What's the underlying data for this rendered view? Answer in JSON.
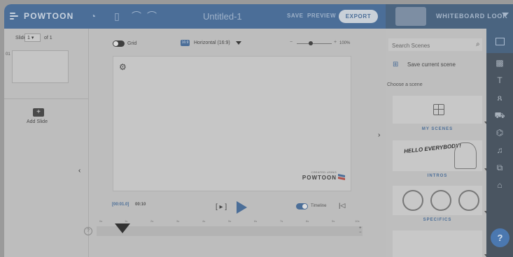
{
  "app": {
    "logo_text": "POWTOON",
    "document_title": "Untitled-1",
    "save_label": "SAVE",
    "preview_label": "PREVIEW",
    "export_label": "EXPORT",
    "look_label": "WHITEBOARD LOOK",
    "colors": {
      "brand": "#4b6e98",
      "header": "#4b6e98",
      "dim_overlay": "#bdbdbd"
    }
  },
  "slides_panel": {
    "slide_label": "Slide",
    "current_slide": "1",
    "of_label": "of 1",
    "slide_number": "01",
    "add_slide_label": "Add Slide"
  },
  "canvas": {
    "grid_label": "Grid",
    "ratio_badge": "16:9",
    "ratio_label": "Horizontal (16:9)",
    "zoom_minus": "−",
    "zoom_plus": "+",
    "zoom_level": "100%",
    "watermark_small": "CREATED USING",
    "watermark_big": "POWTOON"
  },
  "timeline": {
    "current_time": "[00:01.0]",
    "total_time": "00:10",
    "play_bracket": "[ ▸ ]",
    "timeline_label": "Timeline",
    "ruler": [
      "0s",
      "1s",
      "2s",
      "3s",
      "4s",
      "5s",
      "6s",
      "7s",
      "8s",
      "9s",
      "10s"
    ],
    "help_glyph": "?"
  },
  "scenes_panel": {
    "search_placeholder": "Search Scenes",
    "save_scene_label": "Save current scene",
    "choose_label": "Choose a scene",
    "categories": [
      {
        "name": "MY SCENES"
      },
      {
        "name": "INTROS",
        "thumb_text": "HELLO EVERYBODY!"
      },
      {
        "name": "SPECIFICS"
      }
    ]
  },
  "tools": [
    {
      "icon": "background-icon",
      "glyph": "▩"
    },
    {
      "icon": "text-icon",
      "glyph": "T"
    },
    {
      "icon": "characters-icon",
      "glyph": "ጸ"
    },
    {
      "icon": "props-icon",
      "glyph": "⛟"
    },
    {
      "icon": "shapes-icon",
      "glyph": "⌬"
    },
    {
      "icon": "music-icon",
      "glyph": "♫"
    },
    {
      "icon": "media-icon",
      "glyph": "⧉"
    },
    {
      "icon": "specials-icon",
      "glyph": "⌂"
    }
  ],
  "help_button": "?"
}
